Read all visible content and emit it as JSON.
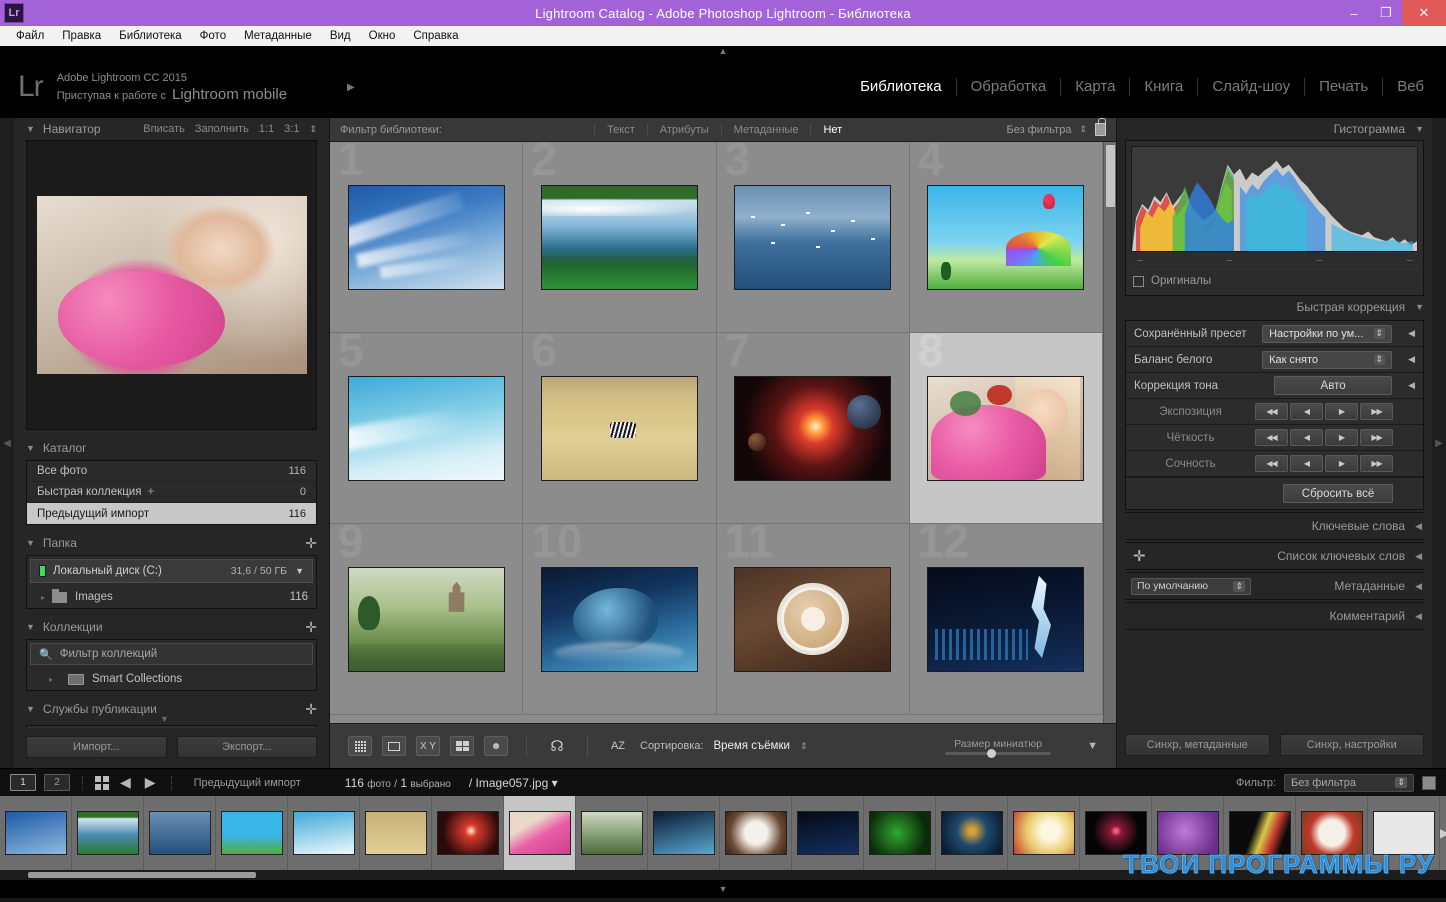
{
  "titlebar": {
    "app_badge": "Lr",
    "title": "Lightroom Catalog - Adobe Photoshop Lightroom - Библиотека",
    "minimize": "–",
    "maximize": "❐",
    "close": "✕"
  },
  "menubar": {
    "items": [
      "Файл",
      "Правка",
      "Библиотека",
      "Фото",
      "Метаданные",
      "Вид",
      "Окно",
      "Справка"
    ]
  },
  "identity": {
    "logo": "Lr",
    "line1": "Adobe Lightroom CC 2015",
    "line2_prefix": "Приступая к работе с",
    "line2_brand": "Lightroom mobile",
    "arrow": "▶"
  },
  "modules": [
    {
      "label": "Библиотека",
      "active": true
    },
    {
      "label": "Обработка",
      "active": false
    },
    {
      "label": "Карта",
      "active": false
    },
    {
      "label": "Книга",
      "active": false
    },
    {
      "label": "Слайд-шоу",
      "active": false
    },
    {
      "label": "Печать",
      "active": false
    },
    {
      "label": "Веб",
      "active": false
    }
  ],
  "left_panel": {
    "navigator": {
      "title": "Навигатор",
      "tri": "▼",
      "modes": [
        "Вписать",
        "Заполнить",
        "1:1",
        "3:1"
      ],
      "spinner": "⇕"
    },
    "catalog": {
      "title": "Каталог",
      "tri": "▼",
      "items": [
        {
          "label": "Все фото",
          "count": "116",
          "selected": false,
          "plus": ""
        },
        {
          "label": "Быстрая коллекция",
          "count": "0",
          "selected": false,
          "plus": "+"
        },
        {
          "label": "Предыдущий импорт",
          "count": "116",
          "selected": true,
          "plus": ""
        }
      ]
    },
    "folders": {
      "title": "Папка",
      "tri": "▼",
      "plus": "✛",
      "drive": {
        "name": "Локальный диск (C:)",
        "size": "31,6 / 50 ГБ",
        "tri": "▼"
      },
      "folder": {
        "name": "Images",
        "count": "116",
        "tri": "▸"
      }
    },
    "collections": {
      "title": "Коллекции",
      "tri": "▼",
      "plus": "✛",
      "filter_placeholder": "Фильтр коллекций",
      "search_icon": "🔍",
      "smart": {
        "label": "Smart Collections",
        "tri": "▸"
      }
    },
    "publish": {
      "title": "Службы публикации",
      "tri": "▼",
      "plus": "✛"
    },
    "buttons": {
      "import": "Импорт...",
      "export": "Экспорт..."
    }
  },
  "filter_bar": {
    "label": "Фильтр библиотеки:",
    "items": [
      {
        "label": "Текст",
        "active": false
      },
      {
        "label": "Атрибуты",
        "active": false
      },
      {
        "label": "Метаданные",
        "active": false
      },
      {
        "label": "Нет",
        "active": true
      }
    ],
    "preset": "Без фильтра",
    "spinner": "⇕",
    "lock_icon": "lock-icon"
  },
  "grid": {
    "cells": [
      {
        "num": "1",
        "alt": "wispy cirrus clouds blue sky",
        "selected": false
      },
      {
        "num": "2",
        "alt": "inverted mountain lake forest",
        "selected": false
      },
      {
        "num": "3",
        "alt": "seagulls over ocean",
        "selected": false
      },
      {
        "num": "4",
        "alt": "rainbow hot air balloon landscape",
        "selected": false
      },
      {
        "num": "5",
        "alt": "turquoise sky clouds",
        "selected": false
      },
      {
        "num": "6",
        "alt": "zebra in savanna grassland",
        "selected": false
      },
      {
        "num": "7",
        "alt": "space planets explosion",
        "selected": false
      },
      {
        "num": "8",
        "alt": "blonde woman with pink roses",
        "selected": true
      },
      {
        "num": "9",
        "alt": "fantasy castle green valley",
        "selected": false
      },
      {
        "num": "10",
        "alt": "blue dragon ocean wave",
        "selected": false
      },
      {
        "num": "11",
        "alt": "latte art cappuccino cup",
        "selected": false
      },
      {
        "num": "12",
        "alt": "music treble clef equalizer",
        "selected": false
      }
    ]
  },
  "toolbar": {
    "icons": [
      "grid-view-icon",
      "loupe-view-icon",
      "compare-view-icon",
      "survey-view-icon",
      "people-view-icon",
      "spray-can-icon",
      "sort-az-icon"
    ],
    "sort_label": "Сортировка:",
    "sort_value": "Время съёмки",
    "sort_spinner": "⇕",
    "thumb_size_label": "Размер миниатюр",
    "caret": "▼"
  },
  "right_panel": {
    "histogram": {
      "title": "Гистограмма",
      "tri": "▼",
      "ticks": [
        "–",
        "–",
        "–",
        "–"
      ],
      "originals_label": "Оригиналы"
    },
    "quick_develop": {
      "title": "Быстрая коррекция",
      "tri": "▼",
      "preset_label": "Сохранённый пресет",
      "preset_value": "Настройки по ум...",
      "wb_label": "Баланс белого",
      "wb_value": "Как снято",
      "tone_label": "Коррекция тона",
      "tone_value": "Авто",
      "sliders": [
        {
          "label": "Экспозиция"
        },
        {
          "label": "Чёткость"
        },
        {
          "label": "Сочность"
        }
      ],
      "step_icons": [
        "◀◀",
        "◀",
        "▶",
        "▶▶"
      ],
      "reset_label": "Сбросить всё"
    },
    "collapsed": [
      {
        "title": "Ключевые слова",
        "tri": "◀",
        "plus": "",
        "select": ""
      },
      {
        "title": "Список ключевых слов",
        "tri": "◀",
        "plus": "✛",
        "select": ""
      },
      {
        "title": "Метаданные",
        "tri": "◀",
        "plus": "",
        "select": "По умолчанию"
      },
      {
        "title": "Комментарий",
        "tri": "◀",
        "plus": "",
        "select": ""
      }
    ],
    "sync": {
      "metadata": "Синхр, метаданные",
      "settings": "Синхр, настройки"
    }
  },
  "filmstrip_bar": {
    "screen1": "1",
    "screen2": "2",
    "grid_icon": "grid-icon",
    "back_arrow": "◀",
    "fwd_arrow": "▶",
    "source": "Предыдущий импорт",
    "photo_count": "116",
    "photo_word": "фото",
    "sep": "/",
    "selected_count": "1",
    "selected_word": "выбрано",
    "filename": "Image057.jpg",
    "file_caret": "▾",
    "filter_label": "Фильтр:",
    "filter_value": "Без фильтра",
    "filter_spinner": "⇕"
  },
  "filmstrip": {
    "thumbs": [
      {
        "alt": "wispy clouds",
        "selected": false
      },
      {
        "alt": "mountain lake",
        "selected": false
      },
      {
        "alt": "seagulls ocean",
        "selected": false
      },
      {
        "alt": "rainbow balloon",
        "selected": false
      },
      {
        "alt": "turquoise sky",
        "selected": false
      },
      {
        "alt": "zebra savanna",
        "selected": false
      },
      {
        "alt": "space planets",
        "selected": false
      },
      {
        "alt": "woman pink roses",
        "selected": true
      },
      {
        "alt": "fantasy castle",
        "selected": false
      },
      {
        "alt": "blue dragon wave",
        "selected": false
      },
      {
        "alt": "latte art",
        "selected": false
      },
      {
        "alt": "music clef",
        "selected": false
      },
      {
        "alt": "green butterfly",
        "selected": false
      },
      {
        "alt": "blue abstract orb",
        "selected": false
      },
      {
        "alt": "red apple",
        "selected": false
      },
      {
        "alt": "fireworks dark",
        "selected": false
      },
      {
        "alt": "purple lilac",
        "selected": false
      },
      {
        "alt": "cocktail glasses",
        "selected": false
      },
      {
        "alt": "seafood plate",
        "selected": false
      },
      {
        "alt": "white blank",
        "selected": false
      }
    ],
    "next_arrow": "▶"
  },
  "watermark": "ТВОИ ПРОГРАММЫ РУ",
  "carets": {
    "top": "▲",
    "bottom": "▼",
    "left": "◀",
    "right": "▶"
  },
  "colors": {
    "titlebar": "#a362d8",
    "close_button": "#e05a5a",
    "panel_bg": "#262626",
    "grid_bg": "#8c8c8c",
    "selected_cell": "#c6c6c6",
    "watermark": "#2b8fe0",
    "drive_led": "#3ddc5a"
  }
}
